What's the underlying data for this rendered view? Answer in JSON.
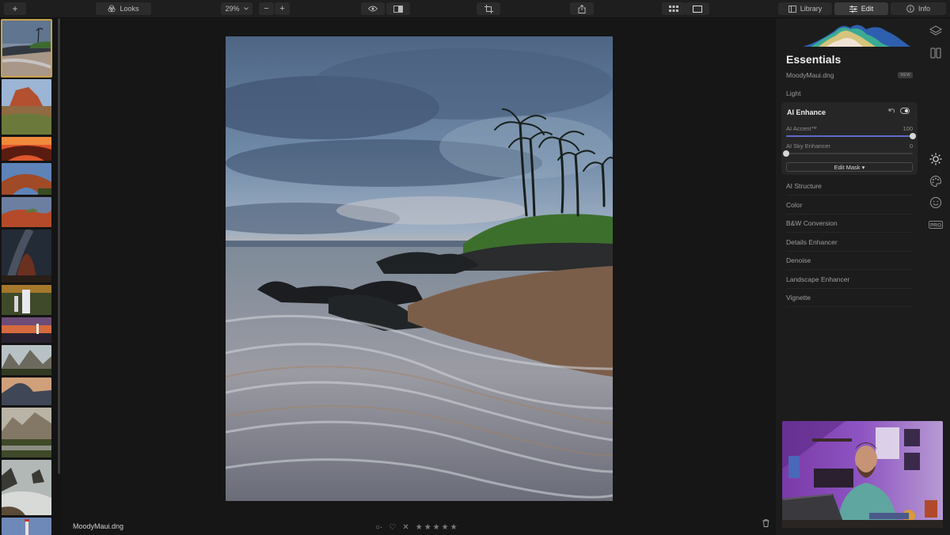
{
  "toolbar": {
    "add_label": "+",
    "looks_label": "Looks",
    "zoom_value": "29%",
    "zoom_out": "−",
    "zoom_in": "+",
    "tabs": [
      {
        "label": "Library",
        "icon": "library-icon",
        "active": false
      },
      {
        "label": "Edit",
        "icon": "sliders-icon",
        "active": true
      },
      {
        "label": "Info",
        "icon": "info-icon",
        "active": false
      }
    ]
  },
  "filmstrip": {
    "items": [
      {
        "name": "beach-thumb",
        "selected": true
      },
      {
        "name": "red-rock-thumb",
        "selected": false
      },
      {
        "name": "arch-sunset-thumb",
        "selected": false
      },
      {
        "name": "desert-arch-thumb",
        "selected": false
      },
      {
        "name": "canyon-thumb",
        "selected": false
      },
      {
        "name": "milky-way-thumb",
        "selected": false
      },
      {
        "name": "waterfall-thumb",
        "selected": false
      },
      {
        "name": "lighthouse-sunset-thumb",
        "selected": false
      },
      {
        "name": "yosemite-thumb",
        "selected": false
      },
      {
        "name": "half-dome-thumb",
        "selected": false
      },
      {
        "name": "valley-thumb",
        "selected": false
      },
      {
        "name": "sea-stack-thumb",
        "selected": false
      },
      {
        "name": "lighthouse-thumb",
        "selected": false
      }
    ]
  },
  "canvas": {
    "filename": "MoodyMaui.dng",
    "rating": {
      "flag": "○·",
      "heart": "♡",
      "reject": "✕",
      "stars": "★★★★★"
    }
  },
  "panel": {
    "title": "Essentials",
    "file_name": "MoodyMaui.dng",
    "badge": "NEW",
    "sections_before": [
      "Light"
    ],
    "ai_enhance": {
      "title": "AI Enhance",
      "sliders": [
        {
          "label": "AI Accent™",
          "value": "100",
          "fraction": 1.0
        },
        {
          "label": "AI Sky Enhancer",
          "value": "0",
          "fraction": 0.0
        }
      ],
      "mask_button": "Edit Mask ▾"
    },
    "sections_after": [
      "AI Structure",
      "Color",
      "B&W Conversion",
      "Details Enhancer",
      "Denoise",
      "Landscape Enhancer",
      "Vignette"
    ]
  },
  "tools": [
    "layers-icon",
    "presets-icon",
    "sun-icon",
    "palette-icon",
    "face-icon",
    "pro-icon"
  ],
  "tools_pro_label": "PRO",
  "colors": {
    "accent": "#c9a24a",
    "slider": "#5d6ac9",
    "panel": "#1c1c1c"
  }
}
